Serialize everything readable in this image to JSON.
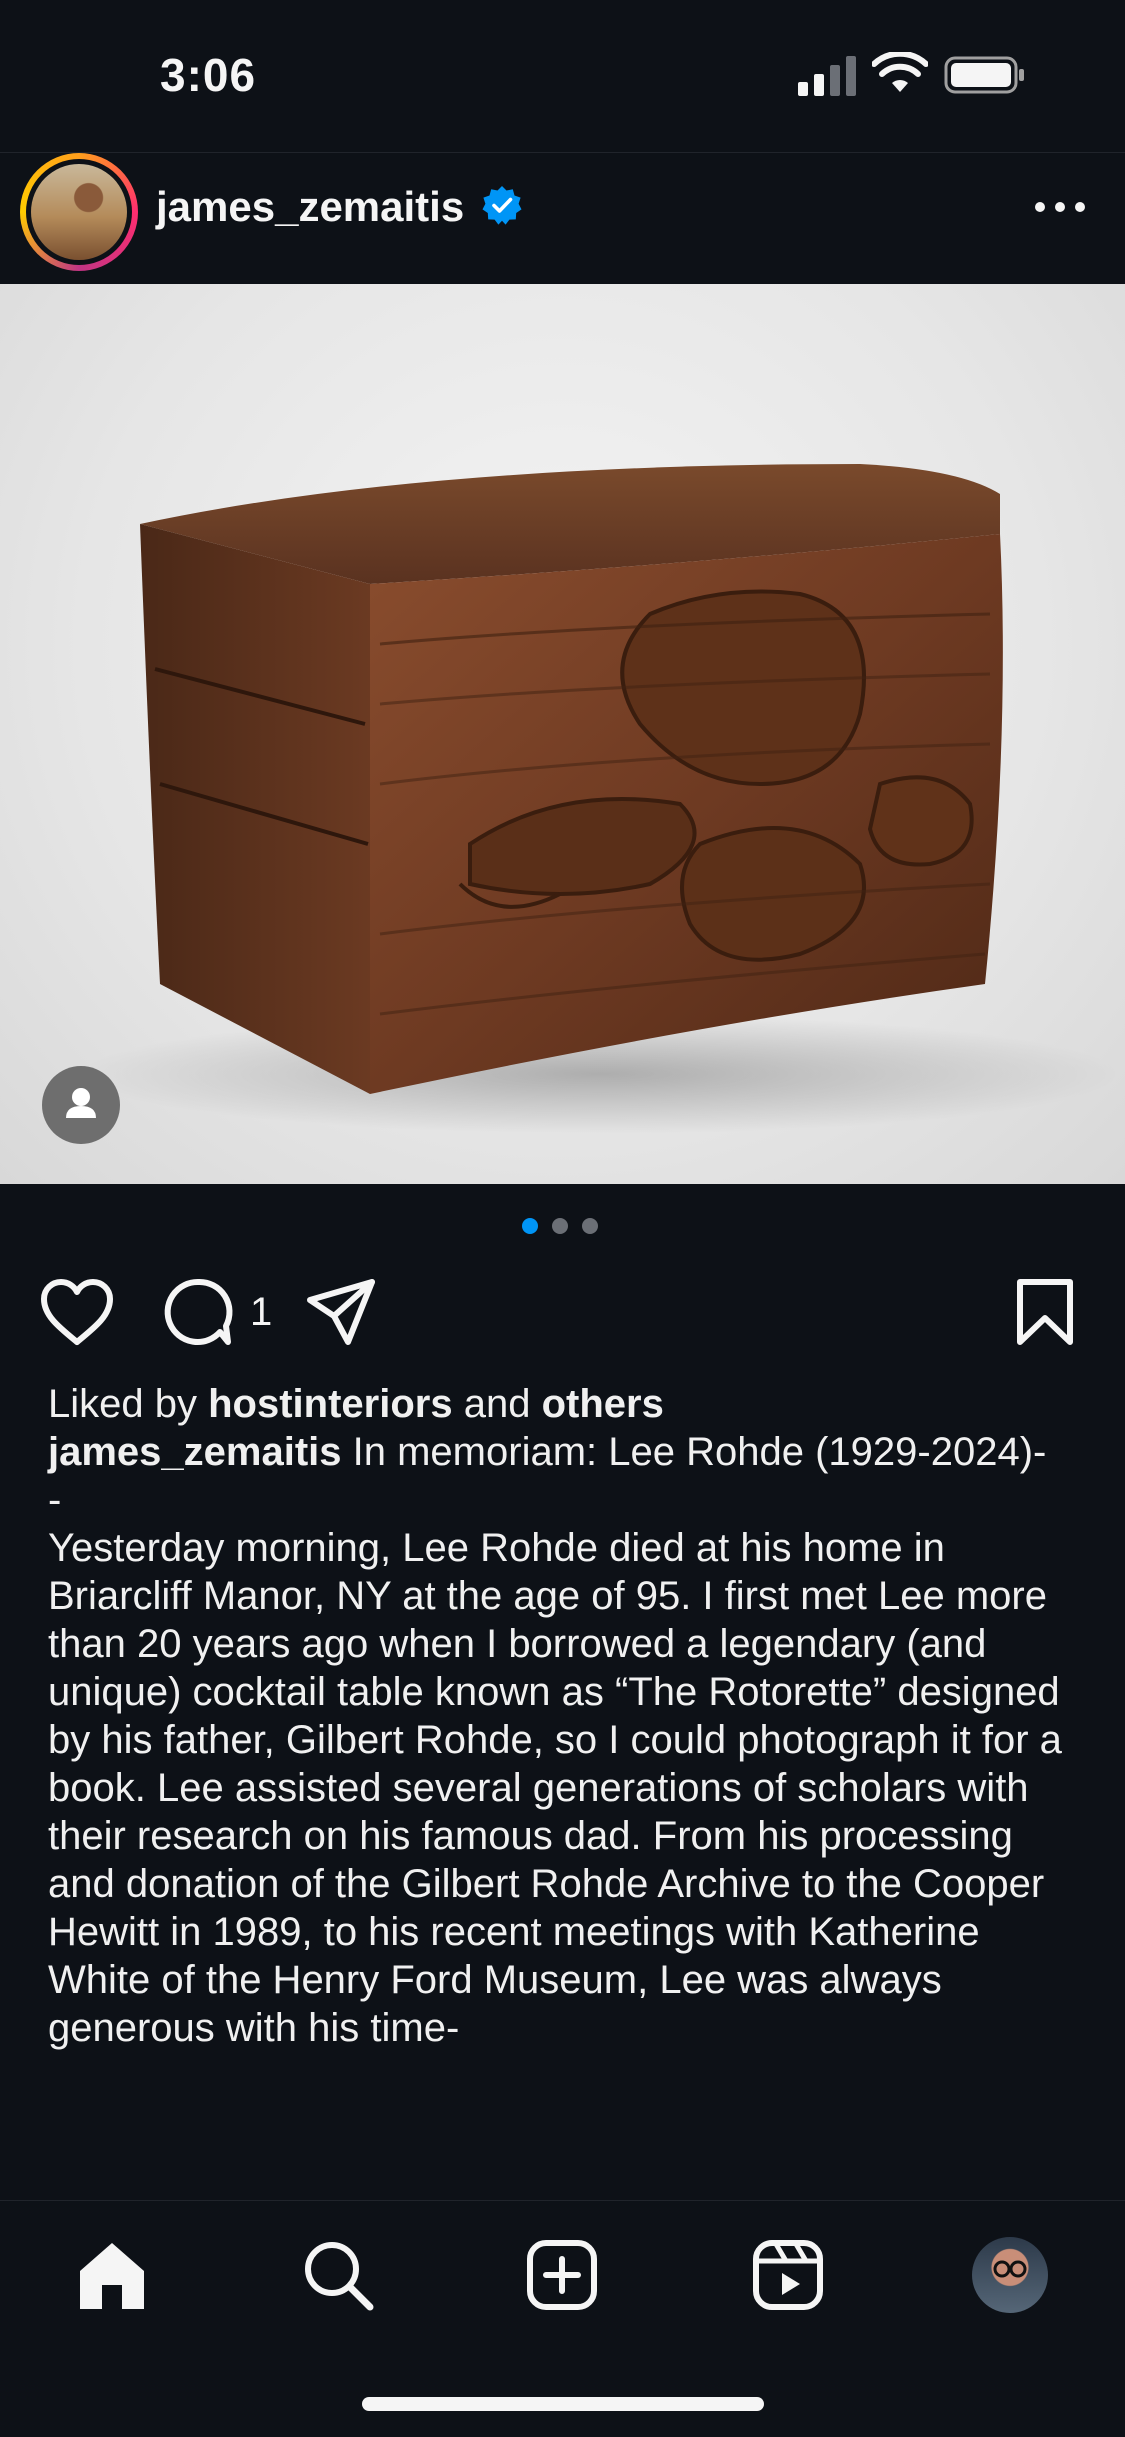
{
  "status_bar": {
    "time": "3:06"
  },
  "post": {
    "username": "james_zemaitis",
    "verified": true,
    "carousel": {
      "count": 3,
      "active_index": 0
    },
    "comment_count": "1",
    "liked_by": {
      "prefix": "Liked by",
      "user": "hostinteriors",
      "and": "and",
      "others": "others"
    },
    "caption": {
      "author": "james_zemaitis",
      "title": "In memoriam: Lee Rohde (1929-2024)-",
      "separator": "-",
      "body": "Yesterday morning, Lee Rohde died at his home in Briarcliff Manor, NY at the age of 95. I first met Lee more than 20 years ago when I borrowed a legendary (and unique) cocktail table known as “The Rotorette” designed by his father, Gilbert Rohde, so I could photograph it for a book.  Lee assisted several generations of scholars with their research on his famous dad. From his processing and donation of the Gilbert Rohde Archive to the Cooper Hewitt in 1989, to his recent meetings with Katherine White of the Henry Ford Museum, Lee was always generous with his time-"
    }
  },
  "icons": {
    "header": [
      "verified-icon",
      "more-icon"
    ],
    "actions": [
      "heart-icon",
      "comment-icon",
      "share-icon",
      "bookmark-icon"
    ],
    "tabs": [
      "home-icon",
      "search-icon",
      "create-icon",
      "reels-icon",
      "profile-avatar"
    ]
  },
  "colors": {
    "background": "#0d1117",
    "accent": "#0095f6",
    "text": "#f5f5f5"
  }
}
